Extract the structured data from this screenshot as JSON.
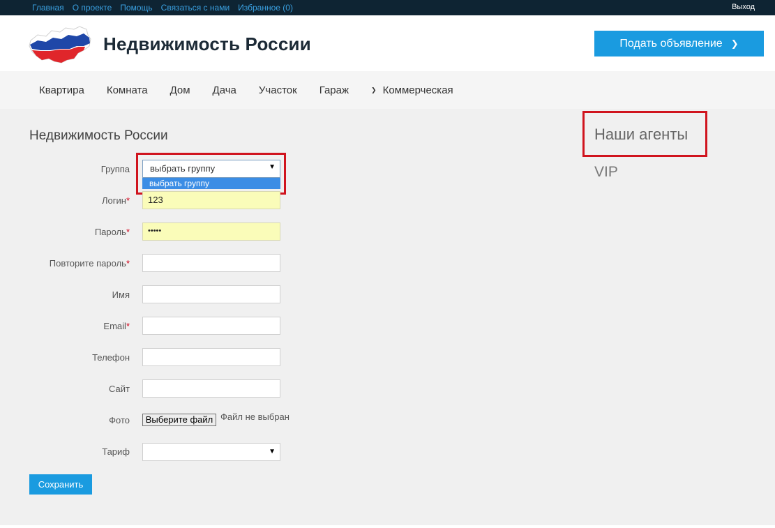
{
  "topbar": {
    "links": [
      "Главная",
      "О проекте",
      "Помощь",
      "Связаться с нами",
      "Избранное (0)"
    ],
    "logout": "Выход"
  },
  "header": {
    "title": "Недвижимость России",
    "post_button": "Подать объявление",
    "logo_icon": "russia-flag-map-logo"
  },
  "nav": {
    "items": [
      "Квартира",
      "Комната",
      "Дом",
      "Дача",
      "Участок",
      "Гараж",
      "Коммерческая"
    ]
  },
  "form": {
    "title": "Недвижимость России",
    "group": {
      "label": "Группа",
      "selected": "выбрать группу",
      "options": [
        "выбрать группу"
      ]
    },
    "login": {
      "label": "Логин",
      "required": "*",
      "value": "123"
    },
    "password": {
      "label": "Пароль",
      "required": "*",
      "value": "•••••"
    },
    "password_repeat": {
      "label": "Повторите пароль",
      "required": "*",
      "value": ""
    },
    "name": {
      "label": "Имя",
      "value": ""
    },
    "email": {
      "label": "Email",
      "required": "*",
      "value": ""
    },
    "phone": {
      "label": "Телефон",
      "value": ""
    },
    "site": {
      "label": "Сайт",
      "value": ""
    },
    "photo": {
      "label": "Фото",
      "button": "Выберите файл",
      "status": "Файл не выбран"
    },
    "tariff": {
      "label": "Тариф",
      "selected": ""
    },
    "save_button": "Сохранить"
  },
  "sidebar": {
    "agents_title": "Наши агенты",
    "vip": "VIP"
  },
  "colors": {
    "accent": "#1a9be0",
    "topbar": "#0e2433",
    "highlight": "#d0141e",
    "autofill": "#fafcb9"
  }
}
